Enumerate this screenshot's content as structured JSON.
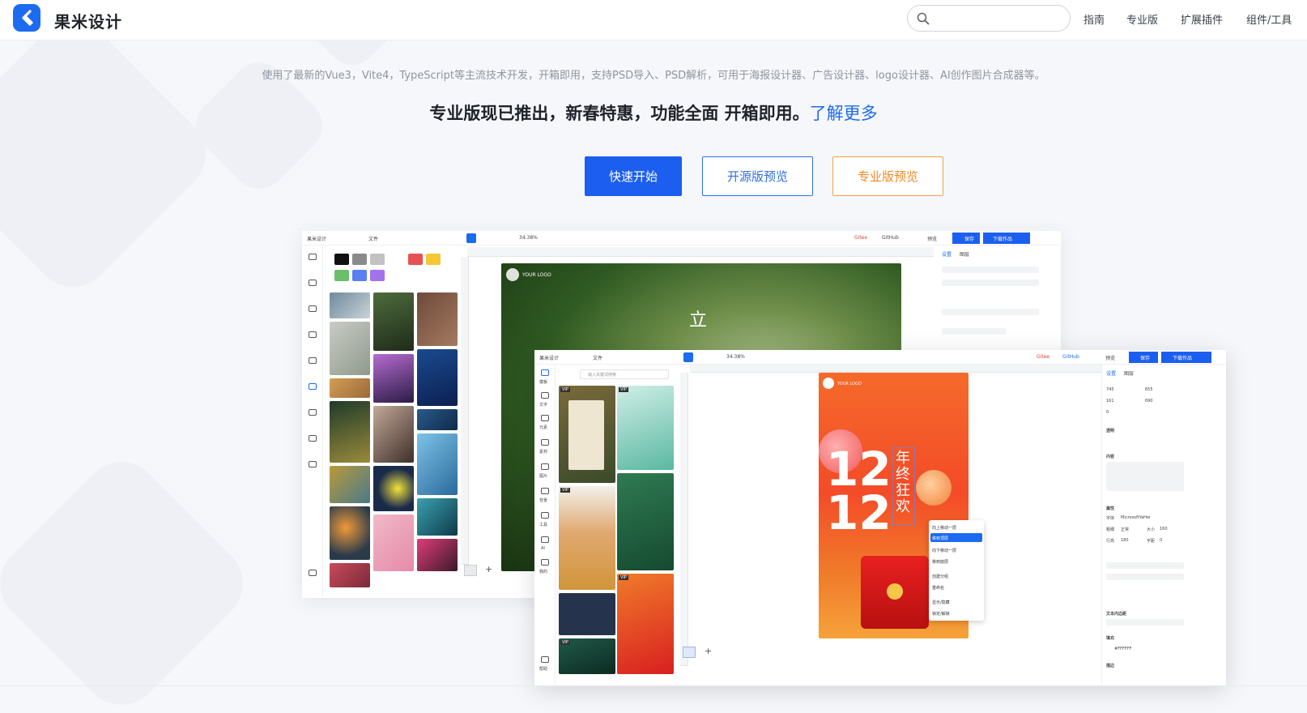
{
  "header": {
    "logo_text": "果米设计",
    "search": {
      "value": "",
      "placeholder": ""
    },
    "nav": [
      "指南",
      "专业版",
      "扩展插件",
      "组件/工具"
    ]
  },
  "hero": {
    "subtitle": "使用了最新的Vue3，Vite4，TypeScript等主流技术开发，开箱即用，支持PSD导入、PSD解析，可用于海报设计器、广告设计器、logo设计器、AI创作图片合成器等。",
    "tagline": "专业版现已推出，新春特惠，功能全面 开箱即用。",
    "learn_more": "了解更多",
    "buttons": {
      "quick_start": "快速开始",
      "open_preview": "开源版预览",
      "pro_preview": "专业版预览"
    }
  },
  "preview_back": {
    "app_name": "果米设计",
    "file_menu": "文件",
    "zoom": "34.38%",
    "gitee": "Gitee",
    "github": "GitHub",
    "preview": "预览",
    "save": "保存",
    "download": "下载作品",
    "panel_tabs": [
      "设置",
      "图层"
    ],
    "canvas_logo": "YOUR LOGO",
    "canvas_char": "立"
  },
  "preview_front": {
    "app_name": "果米设计",
    "file_menu": "文件",
    "zoom": "34.38%",
    "search_placeholder": "输入关键词搜索",
    "gitee": "Gitee",
    "github": "GitHub",
    "preview": "预览",
    "save": "保存",
    "download": "下载作品",
    "panel_tabs": [
      "设置",
      "图层"
    ],
    "rail": [
      "模板",
      "文字",
      "元素",
      "素材",
      "图片",
      "背景",
      "工具",
      "AI",
      "我的",
      "帮助"
    ],
    "templates": [
      "VIP",
      "VIP",
      "VIP",
      "VIP",
      "VIP"
    ],
    "canvas": {
      "logo": "YOUR LOGO",
      "big_text": "12 12",
      "side_text": "年终狂欢"
    },
    "context_menu": [
      "向上移动一层",
      "移到顶层",
      "向下移动一层",
      "移到底层",
      "创建分组",
      "重命名",
      "显示/隐藏",
      "锁定/解锁"
    ],
    "fields": {
      "x": "745",
      "y": "655",
      "w": "161",
      "h": "690",
      "rotate": "0",
      "font": "MicrosoftYaHei",
      "weight": "正常",
      "size": "160",
      "line_height": "180",
      "spacing": "0",
      "fill": "#FFFFFF"
    },
    "labels": [
      "透明",
      "内容",
      "属性",
      "字体",
      "粗细",
      "大小",
      "行高",
      "字距",
      "文本内边距",
      "填充",
      "描边"
    ]
  }
}
